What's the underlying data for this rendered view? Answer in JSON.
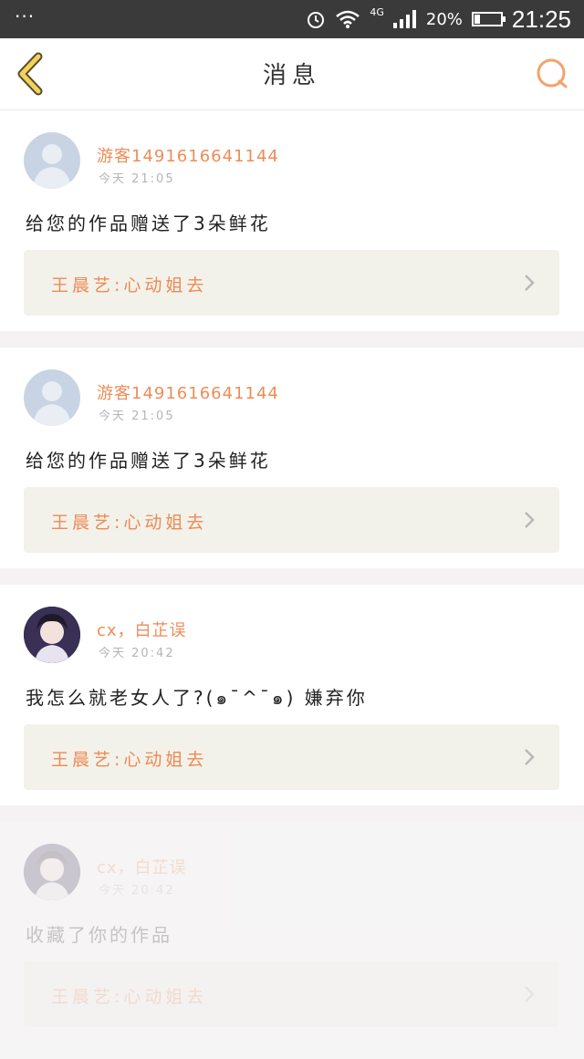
{
  "status": {
    "menu_dots": "···",
    "network": "4G",
    "battery_percent": "20%",
    "battery_level": 0.2,
    "time": "21:25"
  },
  "nav": {
    "title": "消息"
  },
  "messages": [
    {
      "avatar": "default-avatar",
      "name": "游客1491616641144",
      "time": "今天 21:05",
      "content": "给您的作品赠送了3朵鲜花",
      "work_title": "王晨艺:心动姐去"
    },
    {
      "avatar": "default-avatar",
      "name": "游客1491616641144",
      "time": "今天 21:05",
      "content": "给您的作品赠送了3朵鲜花",
      "work_title": "王晨艺:心动姐去"
    },
    {
      "avatar": "photo-avatar",
      "name": "cx，白芷误",
      "time": "今天 20:42",
      "content": "我怎么就老女人了?(๑¯^¯๑) 嫌弃你",
      "work_title": "王晨艺:心动姐去"
    },
    {
      "avatar": "photo-avatar",
      "name": "cx，白芷误",
      "time": "今天 20:42",
      "content": "收藏了你的作品",
      "work_title": "王晨艺:心动姐去"
    }
  ],
  "colors": {
    "accent": "#ee8c57",
    "status_bar": "#3a3a3a",
    "link_bg": "#f3f2ea"
  }
}
